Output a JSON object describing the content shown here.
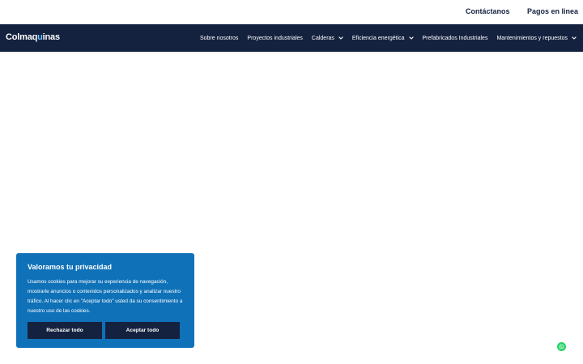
{
  "topbar": {
    "contact": "Contáctanos",
    "payments": "Pagos en linea"
  },
  "logo": {
    "part1": "Colmaq",
    "part2": "u",
    "part3": "inas"
  },
  "nav": {
    "items": [
      {
        "label": "Sobre nosotros",
        "dropdown": false
      },
      {
        "label": "Proyectos industriales",
        "dropdown": false
      },
      {
        "label": "Calderas",
        "dropdown": true
      },
      {
        "label": "Eficiencia energética",
        "dropdown": true
      },
      {
        "label": "Prefabricados Industriales",
        "dropdown": false
      },
      {
        "label": "Mantenimientos y repuestos",
        "dropdown": true
      }
    ]
  },
  "cookie": {
    "title": "Valoramos tu privacidad",
    "text": "Usamos cookies para mejorar su experiencia de navegación, mostrarle anuncios o contenidos personalizados y analizar nuestro tráfico. Al hacer clic en \"Aceptar todo\" usted da su consentimiento a nuestro uso de las cookies.",
    "reject_label": "Rechazar todo",
    "accept_label": "Aceptar todo"
  },
  "icons": {
    "chevron": "chevron-down-icon",
    "whatsapp": "whatsapp-icon"
  },
  "colors": {
    "navy": "#14223f",
    "cookie_blue": "#0f71b8",
    "whatsapp_green": "#25d366",
    "logo_accent": "#6fc3ff"
  }
}
